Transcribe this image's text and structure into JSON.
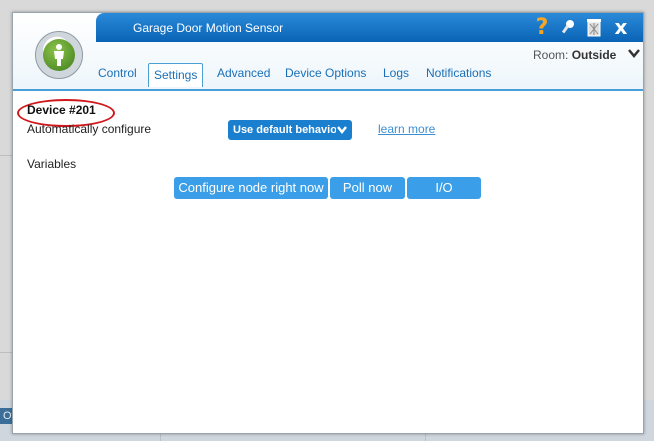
{
  "window": {
    "title": "Garage Door Motion Sensor",
    "room_label": "Room:",
    "room_value": "Outside"
  },
  "icons": {
    "help": "?",
    "close": "x",
    "room_chevron": "❯"
  },
  "tabs": [
    {
      "label": "Control"
    },
    {
      "label": "Settings"
    },
    {
      "label": "Advanced"
    },
    {
      "label": "Device Options"
    },
    {
      "label": "Logs"
    },
    {
      "label": "Notifications"
    }
  ],
  "settings": {
    "device_id": "Device #201",
    "auto_configure_label": "Automatically configure",
    "auto_configure_value": "Use default behavior",
    "learn_more": "learn more",
    "variables_label": "Variables"
  },
  "actions": {
    "configure_now": "Configure node right now",
    "poll_now": "Poll now",
    "io": "I/O"
  },
  "background": {
    "side_label": "Of"
  },
  "colors": {
    "title_bar": "#0a63b6",
    "accent": "#1b7fd0",
    "highlight_circle": "#d0181c",
    "help_icon": "#f5a623"
  }
}
